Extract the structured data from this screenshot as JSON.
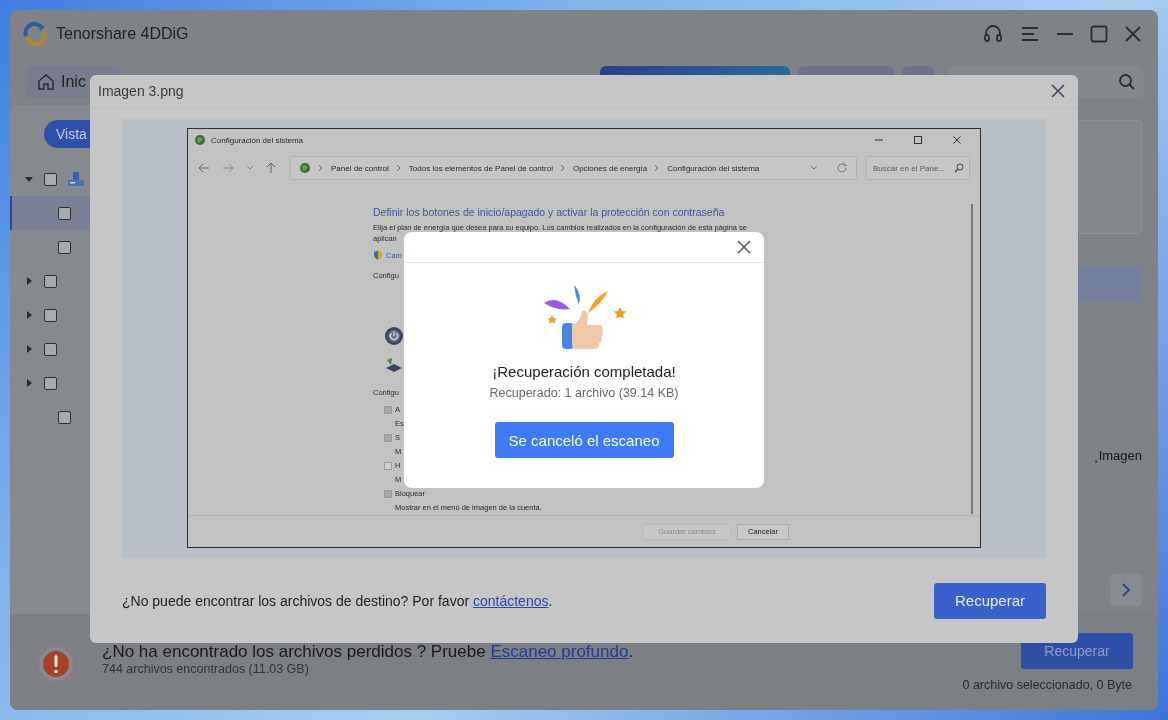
{
  "app": {
    "title": "Tenorshare 4DDiG",
    "home_tab": "Inic",
    "view_button": "Vista",
    "tree_rows": [
      {
        "kind": "drive",
        "expanded": true,
        "checked": false,
        "selected": false
      },
      {
        "kind": "leaf",
        "checked": false,
        "selected": true
      },
      {
        "kind": "leaf",
        "checked": false,
        "selected": false
      },
      {
        "kind": "folder",
        "expanded": false,
        "checked": false,
        "selected": false
      },
      {
        "kind": "folder",
        "expanded": false,
        "checked": false,
        "selected": false
      },
      {
        "kind": "folder",
        "expanded": false,
        "checked": false,
        "selected": false
      },
      {
        "kind": "folder",
        "expanded": false,
        "checked": false,
        "selected": false
      },
      {
        "kind": "plain",
        "checked": false,
        "selected": false
      }
    ],
    "mode_tabs": [
      {
        "selected": true
      },
      {
        "selected": false
      },
      {
        "selected": false
      }
    ],
    "side_label": "¸Imagen",
    "bottom": {
      "message": "¿No ha encontrado los archivos perdidos ? Pruebe ",
      "link": "Escaneo profundo",
      "message_end": ".",
      "count": "744 archivos encontrados (11.03 GB)",
      "button": "Recuperar",
      "selection": "0 archivo seleccionado, 0 Byte"
    }
  },
  "preview": {
    "title": "Imagen 3.png",
    "window": {
      "title": "Configuración del sistema",
      "breadcrumbs": [
        "Panel de control",
        "Todos los elementos de Panel de control",
        "Opciones de energía",
        "Configuración del sistema"
      ],
      "search_placeholder": "Buscar en el Pane...",
      "heading": "Definir los botones de inicio/apagado y activar la protección con contraseña",
      "intro": "Elija el plan de energía que desea para su equipo. Los cambios realizados en la configuración de esta página se",
      "intro_cont": "aplican",
      "items": [
        {
          "kind": "link",
          "text": "Cam"
        },
        {
          "kind": "label",
          "text": "Configu"
        },
        {
          "kind": "power"
        },
        {
          "kind": "battery"
        },
        {
          "kind": "label",
          "text": "Configu"
        },
        {
          "kind": "check",
          "text": "A",
          "checked": true
        },
        {
          "kind": "sub",
          "text": "Es"
        },
        {
          "kind": "check",
          "text": "S",
          "checked": true
        },
        {
          "kind": "sub",
          "text": "M"
        },
        {
          "kind": "check",
          "text": "H",
          "checked": false
        },
        {
          "kind": "sub",
          "text": "M"
        },
        {
          "kind": "check",
          "text": "Bloquear",
          "checked": true
        },
        {
          "kind": "sub",
          "text": "Mostrar en el menú de imagen de la cuenta."
        }
      ],
      "buttons": [
        {
          "label": "Guardar cambios",
          "disabled": true
        },
        {
          "label": "Cancelar",
          "disabled": false
        }
      ]
    },
    "help_text": "¿No puede encontrar los archivos de destino? Por favor ",
    "contact_link": "contáctenos",
    "help_end": ".",
    "button": "Recuperar"
  },
  "success_dialog": {
    "title": "¡Recuperación completada!",
    "subtitle": "Recuperado: 1 archivo (39.14 KB)",
    "button": "Se canceló el escaneo"
  }
}
